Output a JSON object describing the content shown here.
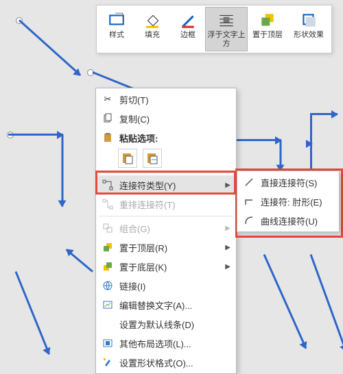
{
  "toolbar": {
    "items": [
      {
        "label": "样式"
      },
      {
        "label": "填充"
      },
      {
        "label": "边框"
      },
      {
        "label": "浮于文字上方",
        "active": true
      },
      {
        "label": "置于顶层"
      },
      {
        "label": "形状效果"
      }
    ]
  },
  "menu": {
    "cut": "剪切(T)",
    "copy": "复制(C)",
    "paste_heading": "粘贴选项:",
    "connector_type": "连接符类型(Y)",
    "reroute": "重排连接符(T)",
    "group": "组合(G)",
    "bring_front": "置于顶层(R)",
    "send_back": "置于底层(K)",
    "link": "链接(I)",
    "alt_text": "编辑替换文字(A)...",
    "default_line": "设置为默认线条(D)",
    "more_layout": "其他布局选项(L)...",
    "format_shape": "设置形状格式(O)..."
  },
  "submenu": {
    "straight": "直接连接符(S)",
    "elbow": "连接符: 肘形(E)",
    "curved": "曲线连接符(U)"
  }
}
